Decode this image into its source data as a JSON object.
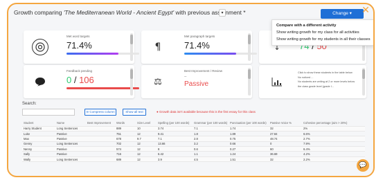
{
  "header": {
    "title_prefix": "Growth comparing ",
    "title_assignment": "'The Mediterranean World - Ancient Egypt'",
    "title_suffix": " with previous assignment *",
    "change_label": "Change ▾"
  },
  "menu": {
    "items": [
      {
        "label": "Compare with a different activity"
      },
      {
        "label": "Show writing growth for my class for all activities"
      },
      {
        "label": "Show writing growth for my students in all their classes"
      }
    ]
  },
  "cards": {
    "word_targets": {
      "label": "Met word targets",
      "value": "71.4%",
      "progress": 71.4,
      "bar_color": "#7a4cf0",
      "icon": "target-icon"
    },
    "paragraph_targets": {
      "label": "Met paragraph targets",
      "value": "71.4%",
      "progress": 71.4,
      "bar_color": "#3b6df0",
      "icon": "pilcrow-icon"
    },
    "third": {
      "value_a": "74",
      "sep": " / ",
      "value_b": "50",
      "icon": "arrow-down-icon"
    },
    "feedback": {
      "label": "Feedback pending",
      "value_a": "0",
      "sep": " / ",
      "value_b": "106",
      "progress": 0,
      "bar_color": "#e94b4b",
      "icon": "speech-bubble-icon"
    },
    "best_improvement": {
      "label": "Best Improvement / Review",
      "dash": "--",
      "value": "Passive",
      "icon": "scales-icon"
    },
    "info": {
      "line1": "Click to show these students in the table below",
      "line2": "No noticed ...",
      "line3": "No students are writing at 2 or more levels below",
      "line4": "the class grade level (grade I...",
      "icon": "chart-icon"
    }
  },
  "search": {
    "label": "Search:",
    "placeholder": "",
    "compress_label": "⊖ Compress column",
    "show_all_label": "Show all text",
    "warning": "● Growth data isn't available because this is the first essay for this class"
  },
  "table": {
    "columns": [
      "Student",
      "Name",
      "Best Improvement",
      "Words",
      "Size Level",
      "Spelling (per 100 words)",
      "Grammar (per 100 words)",
      "Punctuation (per 100 words)",
      "Passive Voice %",
      "Cohesive percentage (aim > 20%)"
    ],
    "rows": [
      [
        "Harry Student",
        "Long Sentences",
        "",
        "889",
        "10",
        "3.74",
        "7.1",
        "1.74",
        "32",
        "2%"
      ],
      [
        "Luke",
        "Passive",
        "",
        "751",
        "12",
        "9.41",
        "1.8",
        "1.89",
        "27.84",
        "6.6%"
      ],
      [
        "Max",
        "Passive",
        "",
        "678",
        "9.7",
        "7.1",
        "2.8",
        "0.75",
        "48.74",
        "2.7%"
      ],
      [
        "Genny",
        "Long Sentences",
        "",
        "702",
        "12",
        "13.66",
        "3.2",
        "0.66",
        "0",
        "7.9%"
      ],
      [
        "Nenny",
        "Passive",
        "",
        "574",
        "12",
        "8",
        "0.6",
        "0.27",
        "60",
        "6.4%"
      ],
      [
        "Sally",
        "Passive",
        "",
        "716",
        "12",
        "6.42",
        "1.1",
        "1.24",
        "36.69",
        "4.2%"
      ],
      [
        "Wally",
        "Long Sentences",
        "",
        "689",
        "12",
        "3.9",
        "4.5",
        "1.51",
        "32",
        "2.2%"
      ]
    ]
  },
  "colors": {
    "accent": "#1f6fd6",
    "frame": "#f4a640",
    "red": "#e94b4b",
    "green": "#2ecc71"
  }
}
